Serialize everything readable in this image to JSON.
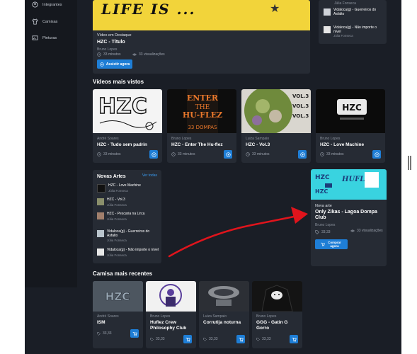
{
  "sidebar": {
    "items": [
      {
        "label": "Integrantes",
        "icon": "users-icon"
      },
      {
        "label": "Camisas",
        "icon": "shirt-icon"
      },
      {
        "label": "Pinturas",
        "icon": "image-icon"
      }
    ]
  },
  "featured": {
    "image_text": "LIFE IS ...",
    "tag": "Vídeo em Destaque",
    "title": "HZC - Título",
    "author": "Bruno Lopes",
    "duration": "33 minutos",
    "views": "33 visualizações",
    "watch_label": "Assistir agora"
  },
  "recommended": {
    "top_author": "Júlia Fonseca",
    "items": [
      {
        "title": "Vidaloca(g) - Guerreiros do Asfalto"
      },
      {
        "title": "Vidaloca(g) - Não importe o nível",
        "author": "Júlia Fonseca"
      }
    ]
  },
  "most_viewed": {
    "title": "Vídeos mais vistos",
    "videos": [
      {
        "thumb_text": "HZC",
        "author": "André Soares",
        "title": "HZC - Tudo sem padrin",
        "duration": "33 minutos"
      },
      {
        "thumb_text": "ENTER THE HU-FLEZ",
        "thumb_sub": "33 DOMPAS",
        "author": "Bruno Lopes",
        "title": "HZC - Enter The Hu-flez",
        "duration": "33 minutos"
      },
      {
        "thumb_text": "VOL.3",
        "author": "Luiza Sampaio",
        "title": "HZC - Vol.3",
        "duration": "33 minutos"
      },
      {
        "thumb_text": "HZC",
        "author": "Bruno Lopes",
        "title": "HZC - Love Machine",
        "duration": "33 minutos"
      }
    ]
  },
  "new_arts": {
    "title": "Novas Artes",
    "see_all": "Ver todas",
    "items": [
      {
        "title": "HZC - Love Machine",
        "author": "Júlia Fonseca"
      },
      {
        "title": "HZC - Vol.3",
        "author": "Júlia Fonseca"
      },
      {
        "title": "HZC - Pescaria na Lirca",
        "author": "Júlia Fonseca"
      },
      {
        "title": "Vidaloca(g) - Guerreiros do Asfalto",
        "author": "Júlia Fonseca"
      },
      {
        "title": "Vidaloca(g) - Não importe o nível",
        "author": "Júlia Fonseca"
      }
    ]
  },
  "new_art": {
    "image_text": "HZC",
    "image_sub": "HUFLEZ",
    "tag": "Nova arte",
    "title": "Only Zikas - Lagoa Dompa Club",
    "author": "Bruno Lopes",
    "price": "33,33",
    "views": "33 visualizações",
    "buy_label": "Comprar agora"
  },
  "shirts": {
    "title": "Camisa mais recentes",
    "items": [
      {
        "thumb_text": "HZC",
        "author": "André Soares",
        "title": "ISM",
        "price": "33,33"
      },
      {
        "thumb_text": "",
        "author": "Bruno Lopes",
        "title": "Huflez Crew Philosophy Club",
        "price": "33,33"
      },
      {
        "thumb_text": "",
        "author": "Luiza Sampaio",
        "title": "Corrutija noturna",
        "price": "33,33"
      },
      {
        "thumb_text": "",
        "author": "Bruno Lopes",
        "title": "GGG - Gatin G Gorro",
        "price": "33,33"
      }
    ]
  },
  "colors": {
    "accent": "#1e7ed6",
    "background": "#1a1e26",
    "card": "#262b34",
    "sidebar": "#15181e",
    "link": "#3a9bf0",
    "annotation_arrow": "#e0141c"
  }
}
